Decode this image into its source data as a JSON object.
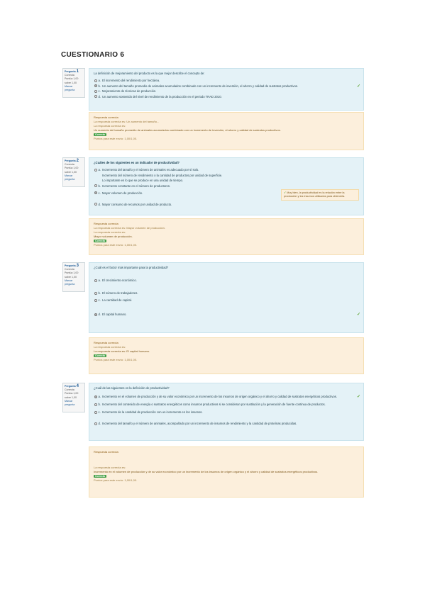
{
  "document": {
    "title": "CUESTIONARIO 6"
  },
  "questions": [
    {
      "info": {
        "label": "Pregunta",
        "number": "1",
        "status": "Correcta",
        "points": "Puntúa 1,00 sobre 1,00",
        "flag": "Marcar pregunta"
      },
      "text": "La definición de mejoramiento del producto es la que mejor describe el concepto de:",
      "options": [
        {
          "letter": "a.",
          "text": "El incremento del rendimiento por hectárea.",
          "selected": false,
          "correct": false
        },
        {
          "letter": "b.",
          "text": "Un aumento del tamaño promedio de animales acumulados combinado con un incremento de inversión, el ahorro y calidad de sustratos productivos.",
          "selected": true,
          "correct": true
        },
        {
          "letter": "c.",
          "text": "Mejoramiento de técnicas de producción.",
          "selected": false,
          "correct": false
        },
        {
          "letter": "d.",
          "text": "Un aumento sostenido del nivel de rendimiento de la producción en el periodo TRAD 2010.",
          "selected": false,
          "correct": false
        }
      ],
      "feedback": {
        "title": "Respuesta correcta",
        "lines": [
          "La respuesta correcta es: Un aumento del tamaño...",
          "La respuesta correcta es:",
          "Un aumento del tamaño promedio de animales acumulados combinado con un incremento de inversión, el ahorro y calidad de sustratos productivos."
        ],
        "tag": "Correcta",
        "score": "Puntos para este envío: 1,00/1,00."
      }
    },
    {
      "info": {
        "label": "Pregunta",
        "number": "2",
        "status": "Correcta",
        "points": "Puntúa 1,00 sobre 1,00",
        "flag": "Marcar pregunta"
      },
      "text": "¿Cuáles de los siguientes es un indicador de productividad?",
      "options": [
        {
          "letter": "a.",
          "text": "Incremento del tamaño y el número de animales es adecuado por sí solo.",
          "selected": false,
          "correct": false
        },
        {
          "letter": "",
          "text": "Incremento del número de rendimiento o la cantidad de productos por unidad de superficie.",
          "selected": false,
          "correct": false
        },
        {
          "letter": "",
          "text": "Lo importante es lo que se produce en una unidad de tiempo.",
          "selected": false,
          "correct": false
        },
        {
          "letter": "b.",
          "text": "Incremento constante en el número de productores.",
          "selected": false,
          "correct": false
        },
        {
          "letter": "c.",
          "text": "Mayor volumen de producción.",
          "selected": true,
          "correct": true
        },
        {
          "letter": "d.",
          "text": "Mayor consumo de recursos por unidad de producto.",
          "selected": false,
          "correct": false
        }
      ],
      "side_feedback": "Muy bien, la productividad es la relación entre la producción y los insumos utilizados para obtenerla.",
      "feedback": {
        "title": "Respuesta correcta",
        "lines": [
          "La respuesta correcta es: Mayor volumen de producción.",
          "La respuesta correcta es:",
          "Mayor volumen de producción."
        ],
        "tag": "Correcta",
        "score": "Puntos para este envío: 1,00/1,00."
      }
    },
    {
      "info": {
        "label": "Pregunta",
        "number": "3",
        "status": "Correcta",
        "points": "Puntúa 1,00 sobre 1,00",
        "flag": "Marcar pregunta"
      },
      "text": "¿Cuál es el factor más importante para la productividad?",
      "options": [
        {
          "letter": "a.",
          "text": "El crecimiento económico.",
          "selected": false,
          "correct": false
        },
        {
          "letter": "b.",
          "text": "El número de trabajadores.",
          "selected": false,
          "correct": false
        },
        {
          "letter": "c.",
          "text": "La cantidad de capital.",
          "selected": false,
          "correct": false
        },
        {
          "letter": "d.",
          "text": "El capital humano.",
          "selected": true,
          "correct": true
        }
      ],
      "feedback": {
        "title": "Respuesta correcta",
        "lines": [
          "La respuesta correcta es:",
          "La respuesta correcta es: El capital humano."
        ],
        "tag": "Correcta",
        "score": "Puntos para este envío: 1,00/1,00."
      }
    },
    {
      "info": {
        "label": "Pregunta",
        "number": "4",
        "status": "Correcta",
        "points": "Puntúa 1,00 sobre 1,00",
        "flag": "Marcar pregunta"
      },
      "text": "¿Cuál de las siguientes es la definición de productividad?",
      "options": [
        {
          "letter": "a.",
          "text": "Incremento en el volumen de producción y de su valor económico por un incremento de los insumos de origen orgánico y el ahorro y calidad de sustratos energéticos productivos.",
          "selected": true,
          "correct": true
        },
        {
          "letter": "b.",
          "text": "Incremento del contenido de energía o sustratos energéticos como insumos productivos si se consideran por sustitución y la generación de fuente continua de productos.",
          "selected": false,
          "correct": false
        },
        {
          "letter": "c.",
          "text": "Incremento de la cantidad de producción con un incremento en los insumos.",
          "selected": false,
          "correct": false
        },
        {
          "letter": "d.",
          "text": "Incremento del tamaño y el número de animales, acompañado por un incremento de insumos de rendimiento y la cantidad de proteínas producidas.",
          "selected": false,
          "correct": false
        }
      ],
      "feedback": {
        "title": "Respuesta correcta",
        "lines": [
          "La respuesta correcta es:",
          "Incremento en el volumen de producción y de su valor económico por un incremento de los insumos de origen orgánico y el ahorro y calidad de sustratos energéticos productivos."
        ],
        "tag": "Correcta",
        "score": "Puntos para este envío: 1,00/1,00."
      }
    }
  ]
}
